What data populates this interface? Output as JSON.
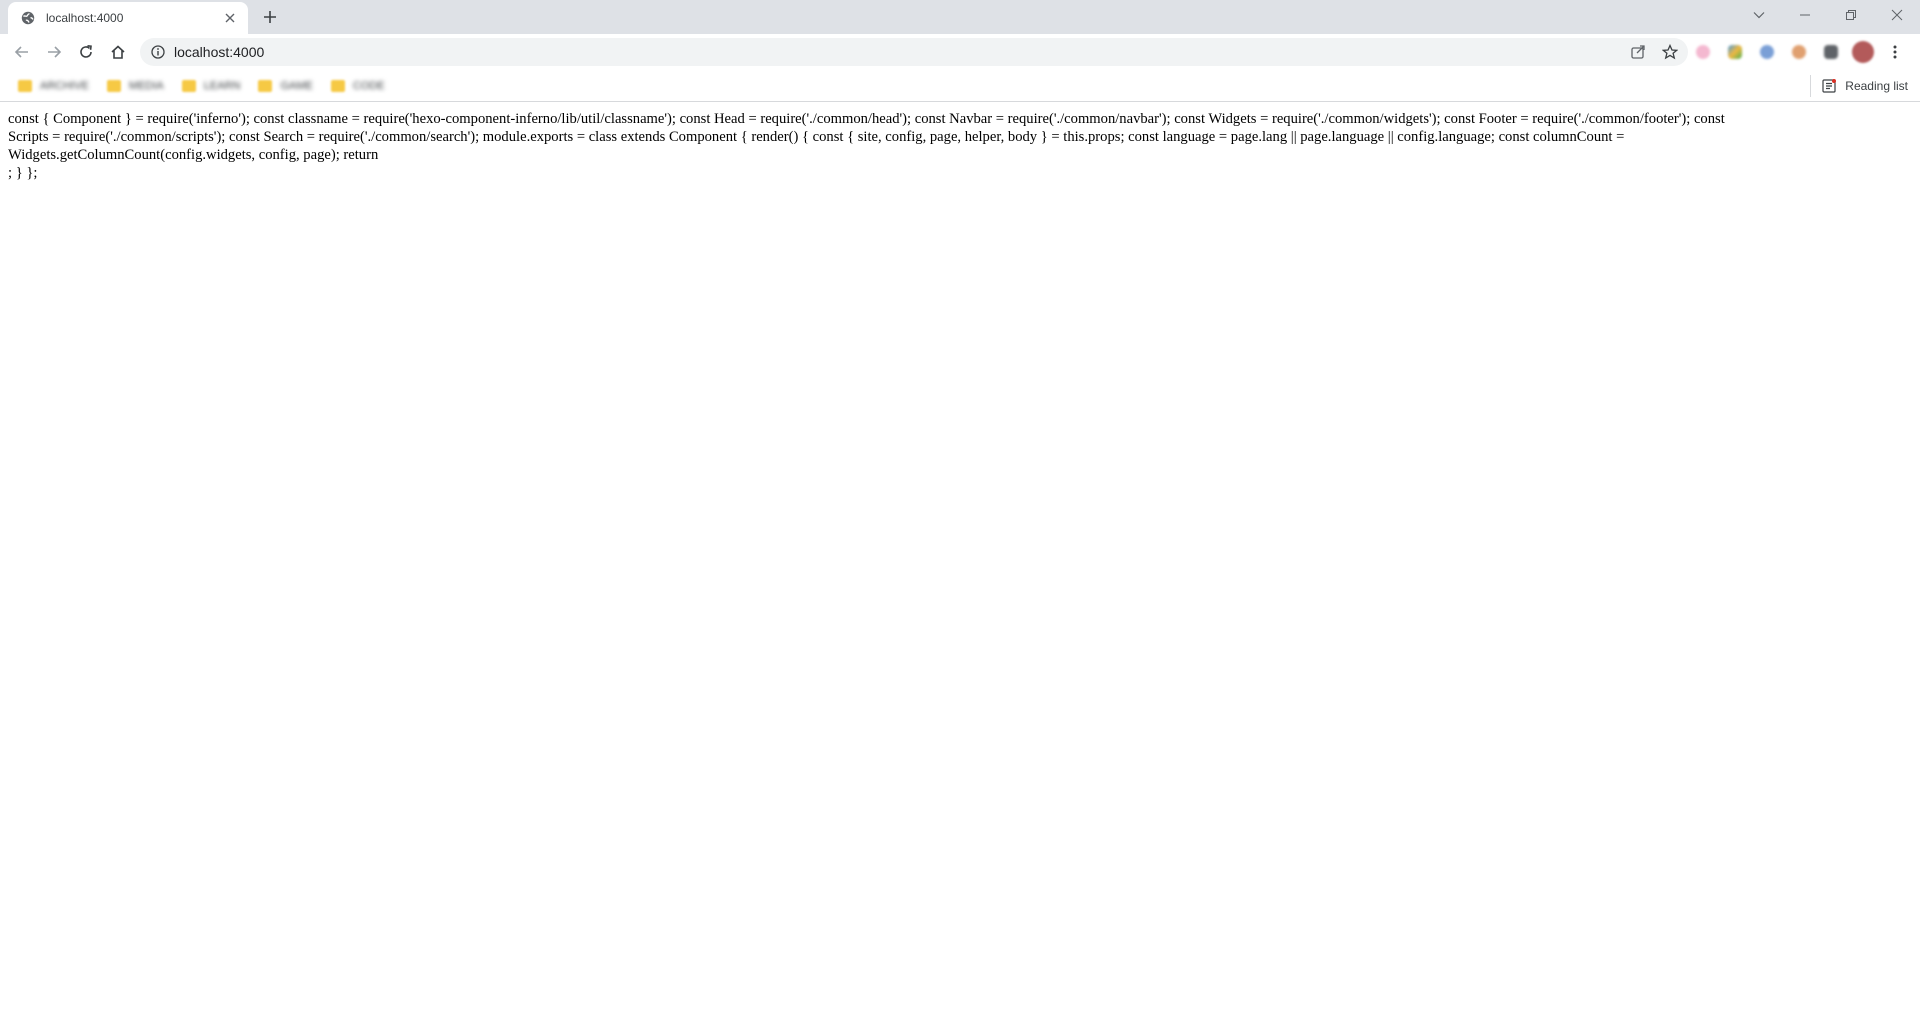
{
  "tab": {
    "title": "localhost:4000",
    "favicon": "globe-icon",
    "close_icon": "close-icon"
  },
  "toolbar": {
    "address": "localhost:4000",
    "info_icon": "info-icon"
  },
  "bookmarks": {
    "items": [
      {
        "label": "ARCHIVE"
      },
      {
        "label": "MEDIA"
      },
      {
        "label": "LEARN"
      },
      {
        "label": "GAME"
      },
      {
        "label": "CODE"
      }
    ],
    "reading_list": "Reading list"
  },
  "page": {
    "line1": "const { Component } = require('inferno'); const classname = require('hexo-component-inferno/lib/util/classname'); const Head = require('./common/head'); const Navbar = require('./common/navbar'); const Widgets = require('./common/widgets'); const Footer = require('./common/footer'); const",
    "line2": "Scripts = require('./common/scripts'); const Search = require('./common/search'); module.exports = class extends Component { render() { const { site, config, page, helper, body } = this.props; const language = page.lang || page.language || config.language; const columnCount =",
    "line3": "Widgets.getColumnCount(config.widgets, config, page); return",
    "line4": "; } };"
  },
  "colors": {
    "tabstrip": "#dee1e6",
    "omnibox": "#f1f3f4",
    "folder": "#f6c944",
    "avatar": "#b35a5a"
  }
}
